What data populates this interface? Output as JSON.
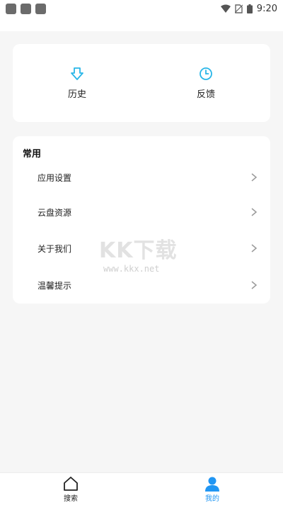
{
  "status": {
    "time": "9:20",
    "icons": [
      "wifi-icon",
      "no-sim-icon",
      "battery-icon"
    ]
  },
  "quick_actions": [
    {
      "label": "历史",
      "icon": "download-arrow-icon"
    },
    {
      "label": "反馈",
      "icon": "clock-icon"
    }
  ],
  "common": {
    "title": "常用",
    "items": [
      {
        "label": "应用设置"
      },
      {
        "label": "云盘资源"
      },
      {
        "label": "关于我们"
      },
      {
        "label": "温馨提示"
      }
    ]
  },
  "watermark": {
    "big": "KK下载",
    "small": "www.kkx.net"
  },
  "bottom_nav": [
    {
      "label": "搜索",
      "icon": "home-icon",
      "active": false
    },
    {
      "label": "我的",
      "icon": "user-icon",
      "active": true
    }
  ],
  "colors": {
    "accent": "#2196f3",
    "icon_teal": "#29b6e8",
    "background": "#f6f6f6"
  }
}
